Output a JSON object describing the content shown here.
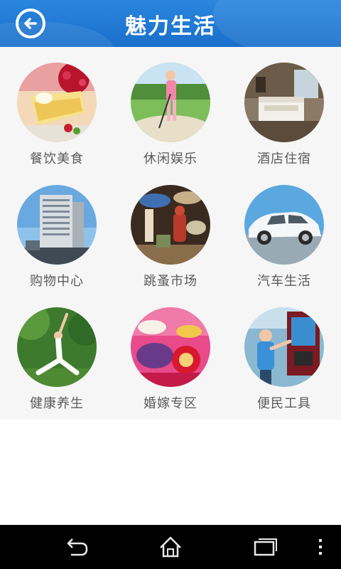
{
  "header": {
    "title": "魅力生活",
    "background_color": "#1a6fcb",
    "back_icon": "back-arrow-circle-icon"
  },
  "grid": {
    "items": [
      {
        "label": "餐饮美食",
        "icon": "food-dessert-image"
      },
      {
        "label": "休闲娱乐",
        "icon": "golf-leisure-image"
      },
      {
        "label": "酒店住宿",
        "icon": "hotel-room-image"
      },
      {
        "label": "购物中心",
        "icon": "shopping-mall-building-image"
      },
      {
        "label": "跳蚤市场",
        "icon": "flea-market-antiques-image"
      },
      {
        "label": "汽车生活",
        "icon": "white-car-image"
      },
      {
        "label": "健康养生",
        "icon": "yoga-pose-image"
      },
      {
        "label": "婚嫁专区",
        "icon": "wedding-gifts-image"
      },
      {
        "label": "便民工具",
        "icon": "self-service-kiosk-image"
      }
    ]
  },
  "navbar": {
    "back_icon": "nav-back-icon",
    "home_icon": "nav-home-icon",
    "recents_icon": "nav-recents-icon",
    "menu_icon": "nav-menu-icon"
  }
}
